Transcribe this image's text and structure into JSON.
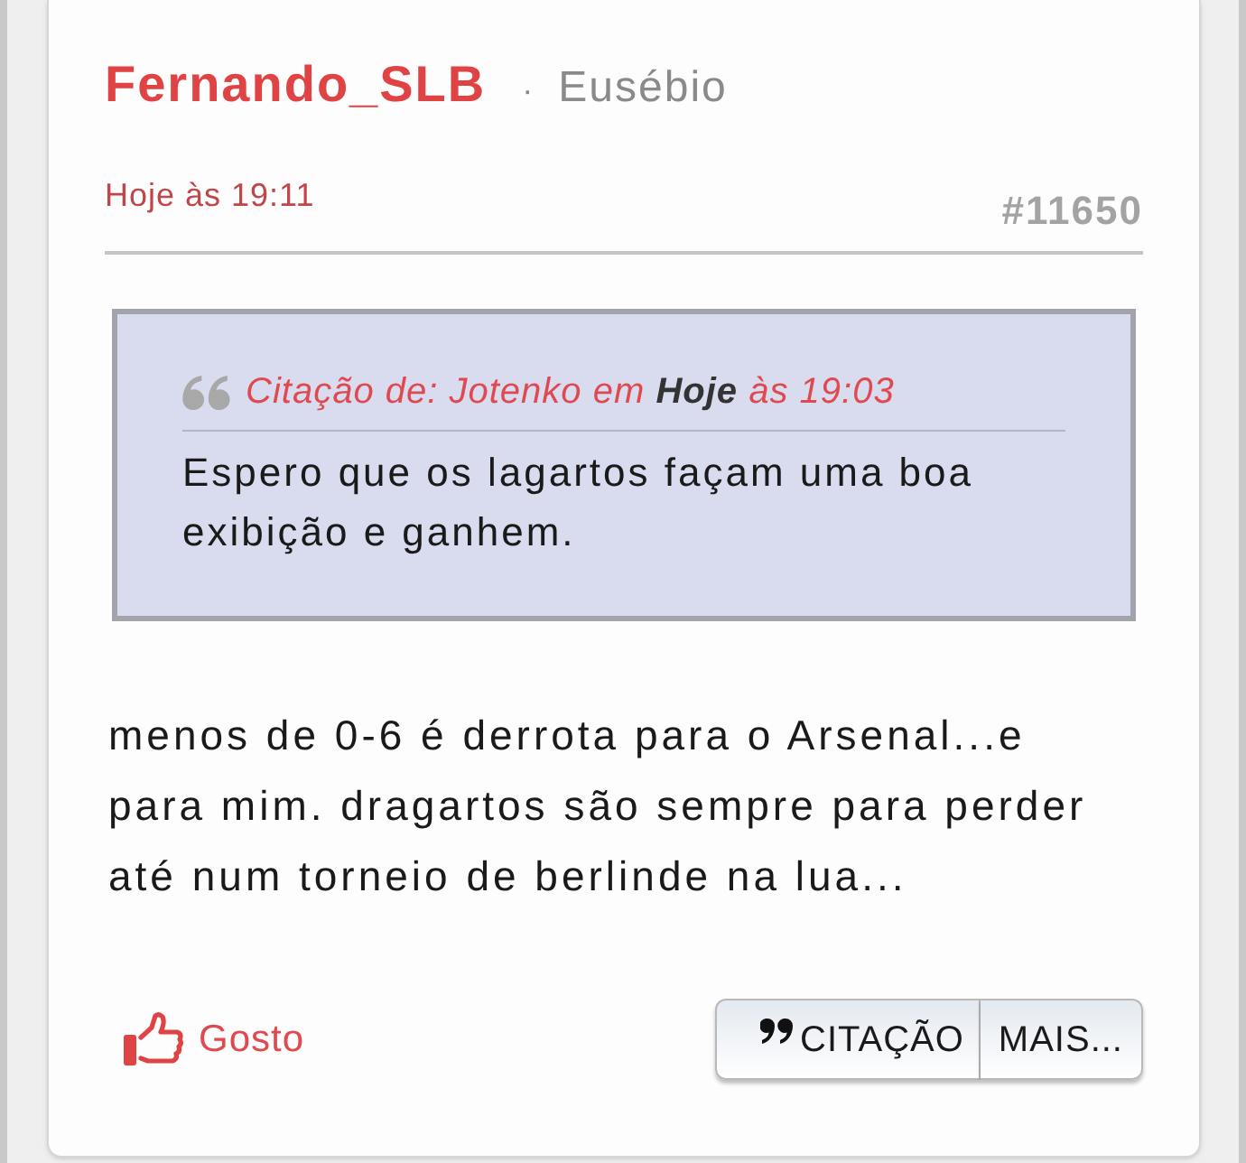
{
  "post": {
    "author": "Fernando_SLB",
    "separator": "·",
    "rank": "Eusébio",
    "time": "Hoje às 19:11",
    "number": "#11650",
    "quote": {
      "header": "Citação de: Jotenko em **Hoje** às 19:03",
      "text": "Espero que os lagartos façam uma boa exibição e ganhem."
    },
    "body": "menos de 0-6 é derrota para o Arsenal...e para mim. dragartos são sempre para perder até num torneio de berlinde na lua...",
    "like": {
      "label": "Gosto"
    },
    "buttons": [
      {
        "kind": "quote",
        "label": "CITAÇÃO"
      },
      {
        "kind": "more",
        "label": "MAIS..."
      }
    ]
  }
}
